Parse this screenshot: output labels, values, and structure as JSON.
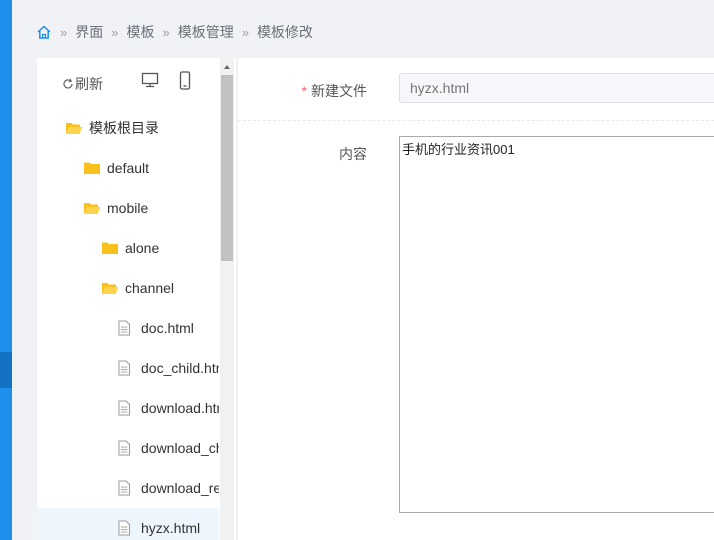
{
  "breadcrumb": [
    "界面",
    "模板",
    "模板管理",
    "模板修改"
  ],
  "tree": {
    "refresh_label": "刷新",
    "items": [
      {
        "label": "模板根目录",
        "type": "folder-open",
        "level": 0
      },
      {
        "label": "default",
        "type": "folder",
        "level": 1
      },
      {
        "label": "mobile",
        "type": "folder-open",
        "level": 1
      },
      {
        "label": "alone",
        "type": "folder",
        "level": 2
      },
      {
        "label": "channel",
        "type": "folder-open",
        "level": 2
      },
      {
        "label": "doc.html",
        "type": "file",
        "level": 3
      },
      {
        "label": "doc_child.html",
        "type": "file",
        "level": 3
      },
      {
        "label": "download.html",
        "type": "file",
        "level": 3
      },
      {
        "label": "download_child.html",
        "type": "file",
        "level": 3
      },
      {
        "label": "download_recommend.html",
        "type": "file",
        "level": 3
      },
      {
        "label": "hyzx.html",
        "type": "file",
        "level": 3,
        "selected": true
      }
    ]
  },
  "form": {
    "file_label": "新建文件",
    "file_placeholder": "hyzx.html",
    "content_label": "内容",
    "content_value": "手机的行业资讯001"
  },
  "colors": {
    "accent": "#1e8fea",
    "folder": "#f7c11d",
    "required": "#f56c6c"
  }
}
